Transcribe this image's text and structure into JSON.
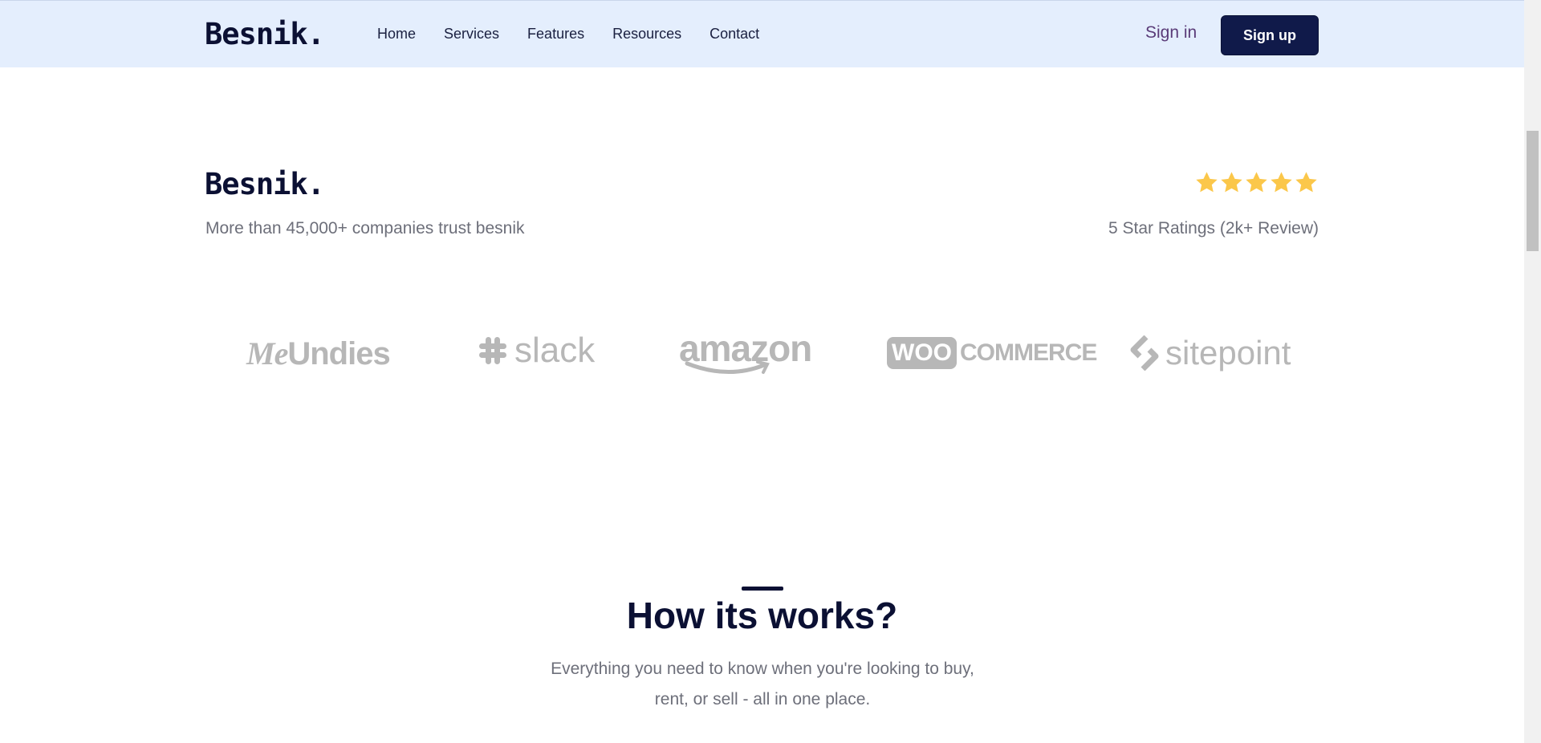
{
  "header": {
    "logo": "Besnik.",
    "nav": [
      {
        "label": "Home"
      },
      {
        "label": "Services"
      },
      {
        "label": "Features"
      },
      {
        "label": "Resources"
      },
      {
        "label": "Contact"
      }
    ],
    "sign_in": "Sign in",
    "sign_up": "Sign up"
  },
  "trust": {
    "logo": "Besnik.",
    "tagline": "More than 45,000+ companies trust besnik",
    "rating_stars": 5,
    "rating_text": "5 Star Ratings (2k+ Review)",
    "star_color": "#fbc74a"
  },
  "brands": {
    "meundies_me": "Me",
    "meundies_rest": "Undies",
    "slack": "slack",
    "amazon": "amazon",
    "woo_badge": "WOO",
    "woo_word": "COMMERCE",
    "sitepoint": "sitepoint"
  },
  "how_it_works": {
    "title": "How its works?",
    "description_line1": "Everything you need to know when you're looking to buy,",
    "description_line2": "rent, or sell - all in one place."
  },
  "colors": {
    "header_bg": "#e4eefd",
    "primary": "#101a4a",
    "text_muted": "#6d6f7a",
    "brand_gray": "#b7b7b7"
  }
}
